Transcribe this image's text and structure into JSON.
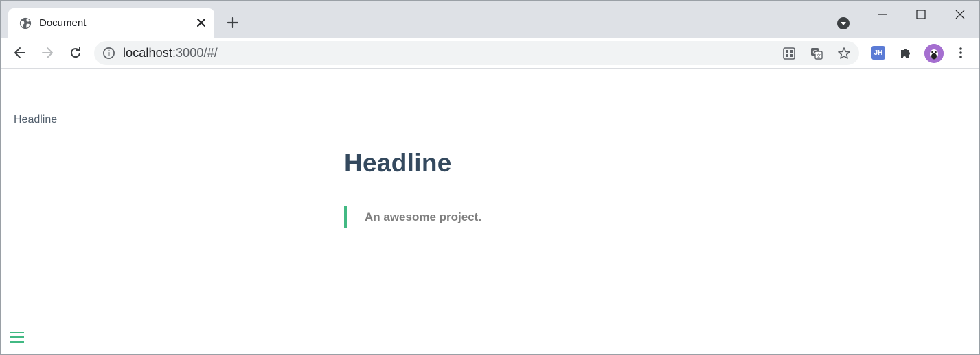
{
  "browser": {
    "tab": {
      "title": "Document",
      "favicon": "globe-icon"
    },
    "address": {
      "host": "localhost",
      "rest": ":3000/#/"
    },
    "extension_badge": "JH"
  },
  "sidebar": {
    "items": [
      {
        "label": "Headline"
      }
    ]
  },
  "page": {
    "title": "Headline",
    "blockquote": "An awesome project."
  },
  "colors": {
    "accent": "#42b983",
    "heading": "#34495e",
    "quote_text": "#7f7f7f",
    "sidebar_text": "#505d6b"
  }
}
